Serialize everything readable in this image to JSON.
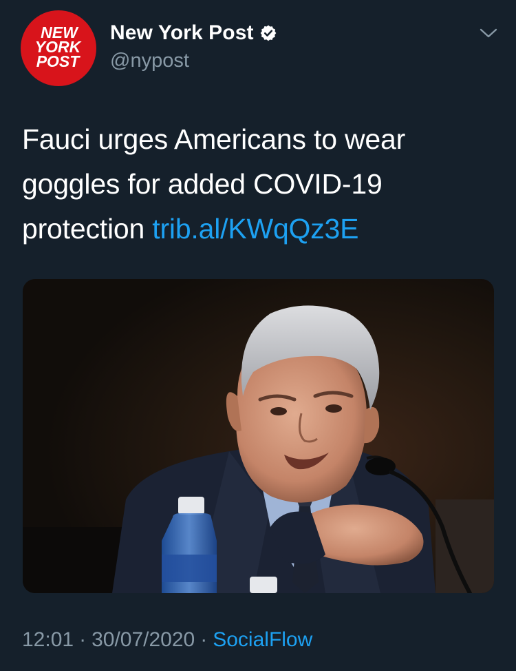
{
  "account": {
    "display_name": "New York Post",
    "handle": "@nypost",
    "verified": true,
    "avatar_logo_text": [
      "NEW",
      "YORK",
      "POST"
    ]
  },
  "tweet": {
    "text": "Fauci urges Americans to wear goggles for added COVID-19 protection",
    "link": "trib.al/KWqQz3E"
  },
  "meta": {
    "time": "12:01",
    "date": "30/07/2020",
    "separator": "·",
    "source": "SocialFlow"
  },
  "icons": {
    "avatar": "new-york-post-logo",
    "verified": "verified-badge-icon",
    "more": "chevron-down-icon"
  },
  "colors": {
    "background": "#15202b",
    "text": "#ffffff",
    "secondary": "#8899a6",
    "link": "#1da1f2",
    "logo_red": "#d8141b"
  }
}
